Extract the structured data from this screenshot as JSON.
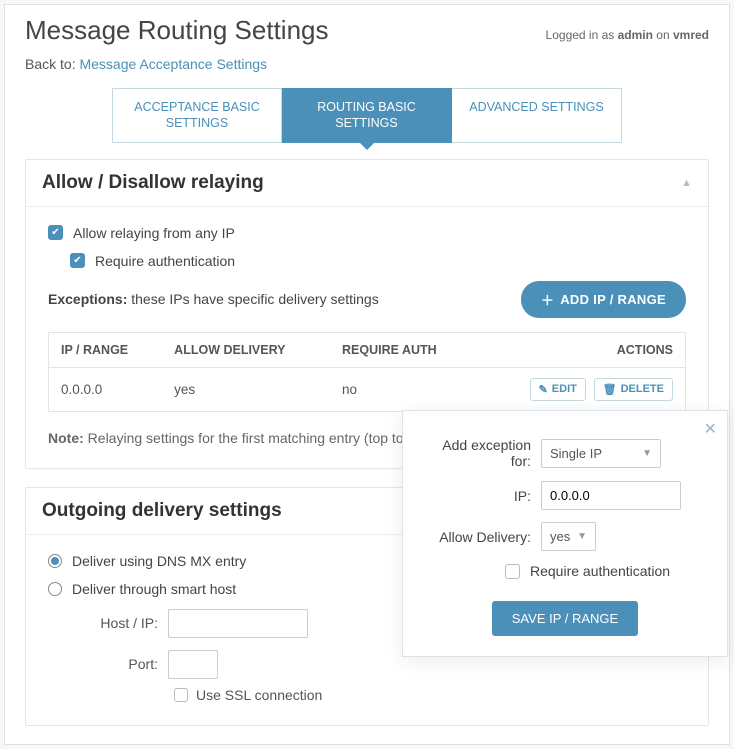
{
  "header": {
    "title": "Message Routing Settings",
    "login_prefix": "Logged in as ",
    "login_user": "admin",
    "login_on": " on ",
    "login_host": "vmred"
  },
  "back": {
    "label": "Back to:",
    "link": "Message Acceptance Settings"
  },
  "tabs": {
    "items": [
      "ACCEPTANCE BASIC SETTINGS",
      "ROUTING BASIC SETTINGS",
      "ADVANCED SETTINGS"
    ],
    "active_index": 1
  },
  "relay": {
    "title": "Allow / Disallow relaying",
    "allow_any_label": "Allow relaying from any IP",
    "require_auth_label": "Require authentication",
    "exceptions_label": "Exceptions:",
    "exceptions_text": " these IPs have specific delivery settings",
    "add_button": "ADD IP / RANGE",
    "columns": {
      "ip": "IP / RANGE",
      "allow": "ALLOW DELIVERY",
      "auth": "REQUIRE AUTH",
      "actions": "ACTIONS"
    },
    "rows": [
      {
        "ip": "0.0.0.0",
        "allow": "yes",
        "auth": "no"
      }
    ],
    "edit": "EDIT",
    "delete": "DELETE",
    "note_label": "Note:",
    "note_text": " Relaying settings for the first matching entry (top to botto"
  },
  "outgoing": {
    "title": "Outgoing delivery settings",
    "opt_dns": "Deliver using DNS MX entry",
    "opt_smart": "Deliver through smart host",
    "host_label": "Host / IP:",
    "port_label": "Port:",
    "ssl_label": "Use SSL connection"
  },
  "popover": {
    "exception_label": "Add exception for:",
    "exception_value": "Single IP",
    "ip_label": "IP:",
    "ip_value": "0.0.0.0",
    "allow_label": "Allow Delivery:",
    "allow_value": "yes",
    "require_auth": "Require authentication",
    "save": "SAVE IP / RANGE"
  }
}
